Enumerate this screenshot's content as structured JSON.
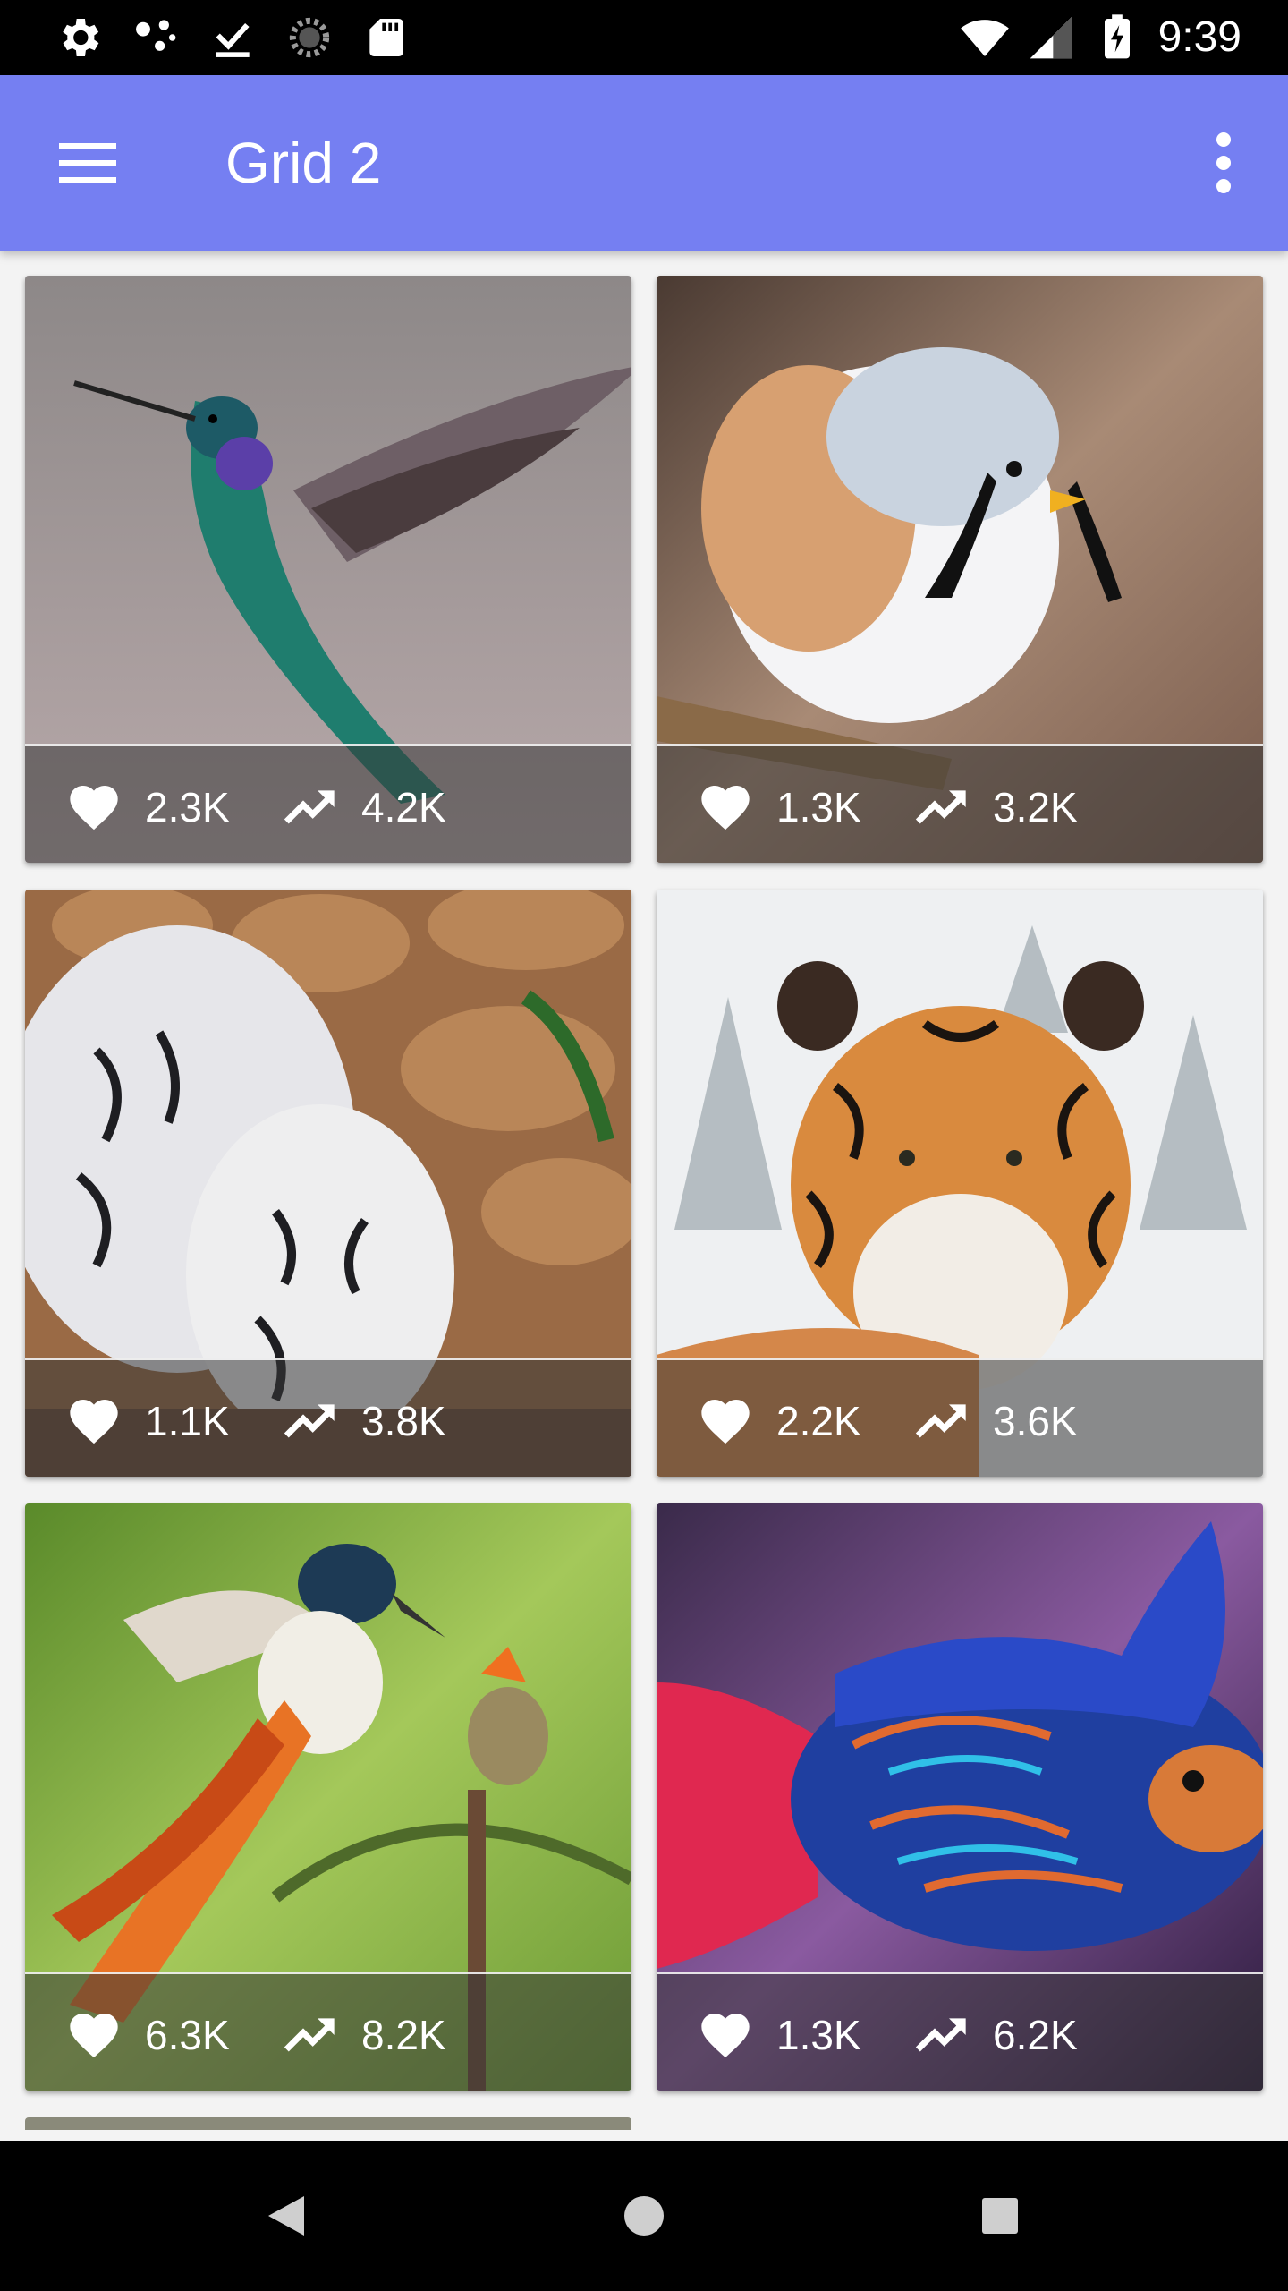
{
  "status_bar": {
    "time": "9:39",
    "icons_left": [
      "settings-icon",
      "dots-icon",
      "download-done-icon",
      "loading-icon",
      "sd-card-icon"
    ],
    "icons_right": [
      "wifi-icon",
      "signal-icon",
      "battery-charging-icon"
    ]
  },
  "app_bar": {
    "title": "Grid 2",
    "menu_icon": "menu-icon",
    "more_icon": "more-vert-icon",
    "color": "#757ff2"
  },
  "cards": [
    {
      "subject": "hummingbird",
      "likes": "2.3K",
      "trend": "4.2K"
    },
    {
      "subject": "bearded-reedling",
      "likes": "1.3K",
      "trend": "3.2K"
    },
    {
      "subject": "white-tigers",
      "likes": "1.1K",
      "trend": "3.8K"
    },
    {
      "subject": "siberian-tiger",
      "likes": "2.2K",
      "trend": "3.6K"
    },
    {
      "subject": "paradise-flycatcher",
      "likes": "6.3K",
      "trend": "8.2K"
    },
    {
      "subject": "mandarin-fish",
      "likes": "1.3K",
      "trend": "6.2K"
    }
  ],
  "nav_bar": {
    "icons": [
      "back-icon",
      "home-icon",
      "recents-icon"
    ]
  }
}
